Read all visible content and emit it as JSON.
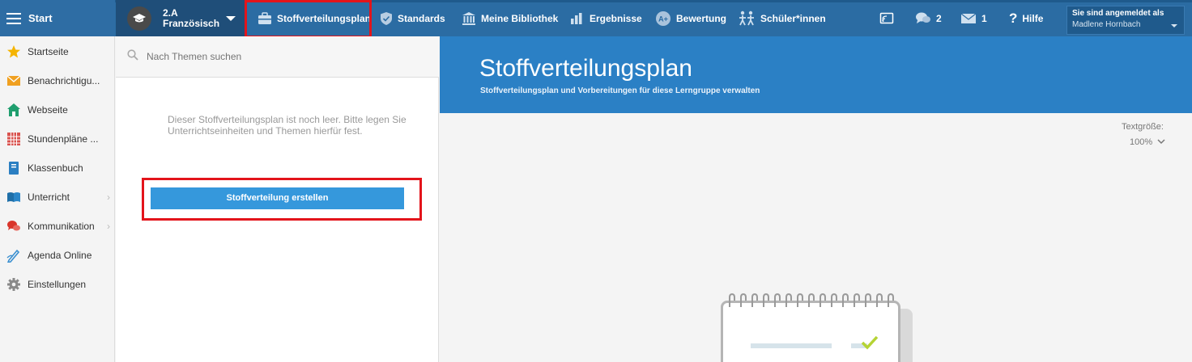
{
  "header": {
    "start_label": "Start",
    "class_group": {
      "line1": "2.A",
      "line2": "Französisch"
    },
    "nav": [
      {
        "label": "Stoffverteilungsplan",
        "icon": "briefcase-icon"
      },
      {
        "label": "Standards",
        "icon": "shield-icon"
      },
      {
        "label": "Meine Bibliothek",
        "icon": "library-icon"
      },
      {
        "label": "Ergebnisse",
        "icon": "bar-chart-icon"
      },
      {
        "label": "Bewertung",
        "icon": "grading-icon"
      },
      {
        "label": "Schüler*innen",
        "icon": "students-icon"
      }
    ],
    "messages_count": "2",
    "mail_count": "1",
    "help_label": "Hilfe",
    "user": {
      "line1": "Sie sind angemeldet als",
      "name": "Madlene Hornbach"
    }
  },
  "sidebar": {
    "items": [
      {
        "label": "Startseite",
        "icon": "star-icon"
      },
      {
        "label": "Benachrichtigu...",
        "icon": "envelope-icon"
      },
      {
        "label": "Webseite",
        "icon": "home-icon"
      },
      {
        "label": "Stundenpläne ...",
        "icon": "calendar-grid-icon"
      },
      {
        "label": "Klassenbuch",
        "icon": "book-icon"
      },
      {
        "label": "Unterricht",
        "icon": "open-book-icon"
      },
      {
        "label": "Kommunikation",
        "icon": "chat-icon"
      },
      {
        "label": "Agenda Online",
        "icon": "pen-icon"
      },
      {
        "label": "Einstellungen",
        "icon": "gear-icon"
      }
    ]
  },
  "middle": {
    "search_placeholder": "Nach Themen suchen",
    "empty_message": "Dieser Stoffverteilungsplan ist noch leer. Bitte legen Sie Unterrichtseinheiten und Themen hierfür fest.",
    "create_button": "Stoffverteilung erstellen"
  },
  "main": {
    "title": "Stoffverteilungsplan",
    "subtitle": "Stoffverteilungsplan und Vorbereitungen für diese Lerngruppe verwalten",
    "text_size_label": "Textgröße:",
    "text_size_value": "100%"
  },
  "colors": {
    "topbar": "#2b6ca3",
    "hero": "#2b80c5",
    "button": "#3598dc",
    "highlight": "#e3141b"
  }
}
